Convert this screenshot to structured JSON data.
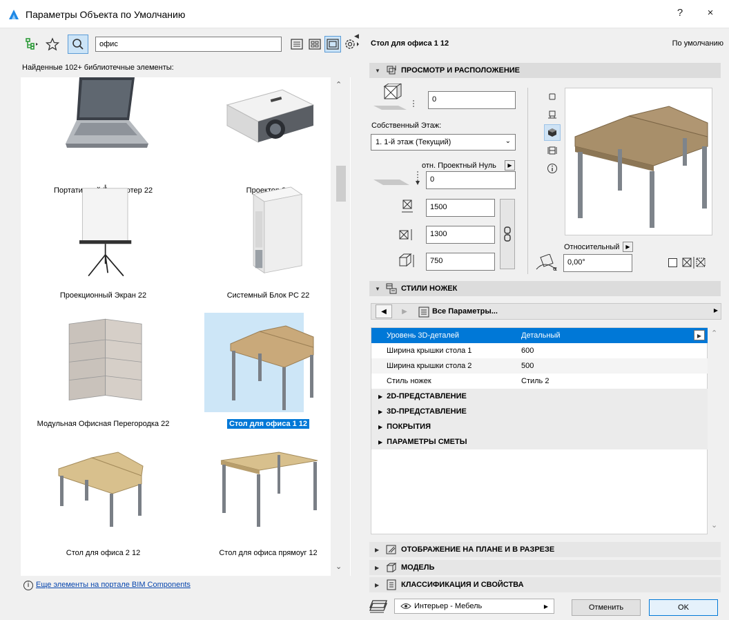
{
  "window": {
    "title": "Параметры Объекта по Умолчанию",
    "help_label": "?",
    "close_label": "×"
  },
  "library": {
    "search_value": "офис",
    "found_label": "Найденные 102+ библиотечные элементы:",
    "items": [
      {
        "label": "Портативный Компьютер 22",
        "icon": "laptop-icon"
      },
      {
        "label": "Проектор 22",
        "icon": "projector-icon"
      },
      {
        "label": "Проекционный Экран 22",
        "icon": "projection-screen-icon"
      },
      {
        "label": "Системный Блок PC 22",
        "icon": "pc-tower-icon"
      },
      {
        "label": "Модульная Офисная Перегородка 22",
        "icon": "partition-icon"
      },
      {
        "label": "Стол для офиса 1 12",
        "icon": "l-desk-icon",
        "selected": true
      },
      {
        "label": "Стол для офиса 2 12",
        "icon": "l-desk-icon"
      },
      {
        "label": "Стол для офиса прямоуг 12",
        "icon": "rect-desk-icon"
      }
    ],
    "bim_link": "Еще элементы на портале BIM Components"
  },
  "settings": {
    "object_name": "Стол для офиса 1 12",
    "default_label": "По умолчанию",
    "section_view": "ПРОСМОТР И РАСПОЛОЖЕНИЕ",
    "elevation_value": "0",
    "home_story_label": "Собственный Этаж:",
    "home_story_value": "1. 1-й этаж (Текущий)",
    "ref_label": "отн. Проектный Нуль",
    "ref_value": "0",
    "width_value": "1500",
    "depth_value": "1300",
    "height_value": "750",
    "relative_label": "Относительный",
    "angle_value": "0,00°",
    "section_legs": "СТИЛИ НОЖЕК",
    "all_params": "Все Параметры...",
    "params": [
      {
        "name": "Уровень 3D-деталей",
        "value": "Детальный",
        "selected": true
      },
      {
        "name": "Ширина крышки стола 1",
        "value": "600"
      },
      {
        "name": "Ширина крышки стола 2",
        "value": "500"
      },
      {
        "name": "Стиль ножек",
        "value": "Стиль 2"
      }
    ],
    "groups": [
      "2D-ПРЕДСТАВЛЕНИЕ",
      "3D-ПРЕДСТАВЛЕНИЕ",
      "ПОКРЫТИЯ",
      "ПАРАМЕТРЫ СМЕТЫ"
    ],
    "section_plan": "ОТОБРАЖЕНИЕ НА ПЛАНЕ И В РАЗРЕЗЕ",
    "section_model": "МОДЕЛЬ",
    "section_class": "КЛАССИФИКАЦИЯ И СВОЙСТВА"
  },
  "footer": {
    "layer_value": "Интерьер - Мебель",
    "cancel_label": "Отменить",
    "ok_label": "OK"
  },
  "colors": {
    "accent": "#0078d7",
    "wood": "#c9a97a",
    "metal": "#8a8f96"
  }
}
